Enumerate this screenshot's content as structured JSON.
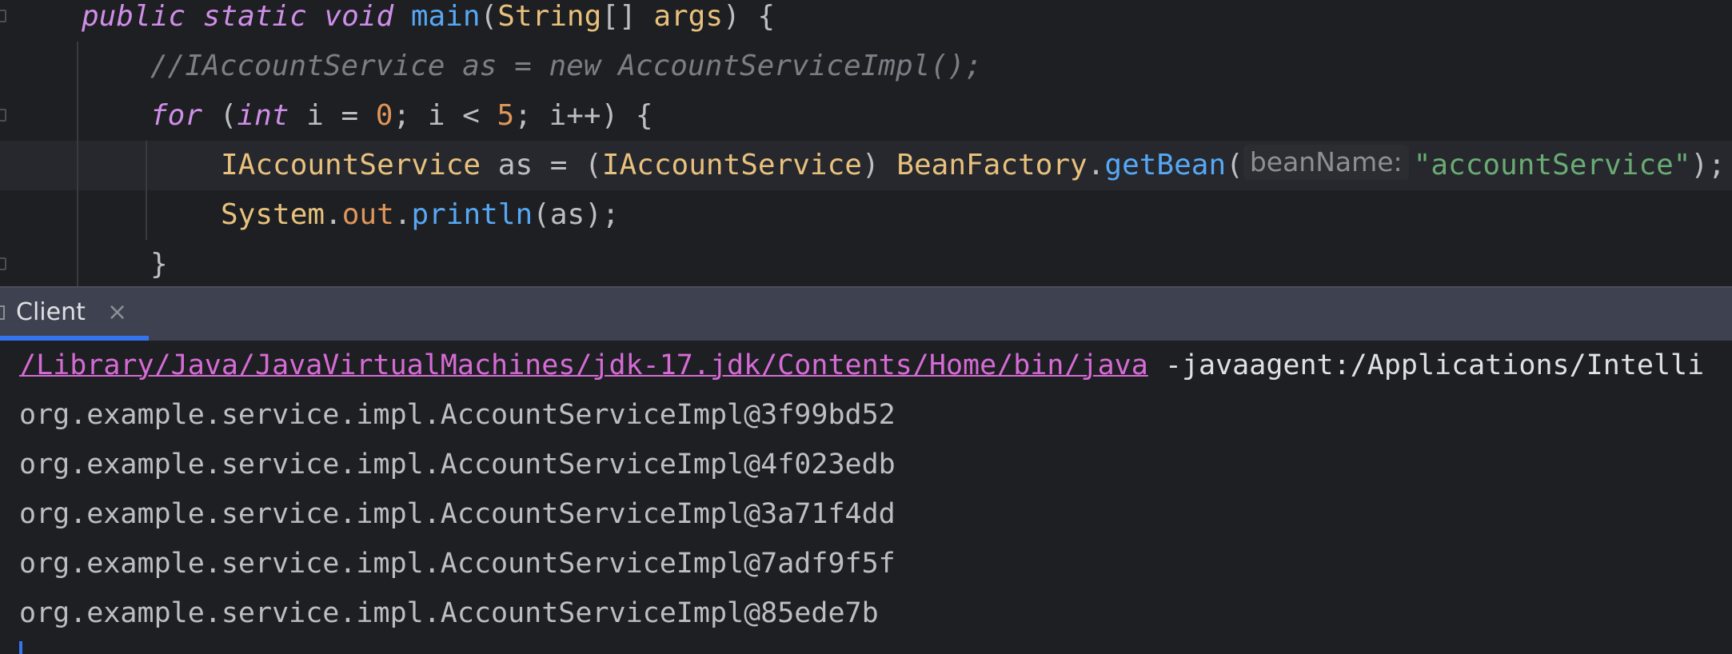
{
  "editor": {
    "line1": {
      "mods": "public static void",
      "method": "main",
      "open_paren": "(",
      "param_type": "String",
      "brackets": "[]",
      "param_name": "args",
      "close": ") {"
    },
    "line2": {
      "comment": "//IAccountService as = new AccountServiceImpl();"
    },
    "line3": {
      "kw_for": "for",
      "open": " (",
      "kw_int": "int",
      "mid1": " i = ",
      "zero": "0",
      "mid2": "; i < ",
      "five": "5",
      "tail": "; i++) {"
    },
    "line4": {
      "type1": "IAccountService",
      "mid1": " as = (",
      "type2": "IAccountService",
      "mid2": ") ",
      "factory": "BeanFactory",
      "dot": ".",
      "method": "getBean",
      "open": "(",
      "hint": "beanName:",
      "string": "\"accountService\"",
      "close": ");"
    },
    "line5": {
      "cls": "System",
      "dot1": ".",
      "field": "out",
      "dot2": ".",
      "method": "println",
      "args": "(as);"
    },
    "line6": {
      "brace": "}"
    }
  },
  "run_tab": {
    "label": "Client",
    "close_glyph": "×"
  },
  "console": {
    "command_path": "/Library/Java/JavaVirtualMachines/jdk-17.jdk/Contents/Home/bin/java",
    "command_rest": " -javaagent:/Applications/Intelli",
    "output": [
      "org.example.service.impl.AccountServiceImpl@3f99bd52",
      "org.example.service.impl.AccountServiceImpl@4f023edb",
      "org.example.service.impl.AccountServiceImpl@3a71f4dd",
      "org.example.service.impl.AccountServiceImpl@7adf9f5f",
      "org.example.service.impl.AccountServiceImpl@85ede7b"
    ]
  },
  "colors": {
    "editor_bg": "#1e1f22",
    "keyword": "#cf8ee8",
    "method": "#56a8f5",
    "type": "#e8c17c",
    "number": "#e0955a",
    "string": "#6aab73",
    "comment": "#7a7e85",
    "tab_bar": "#3e4250",
    "accent": "#3574f0",
    "link": "#d66bd6"
  },
  "icons": {
    "fold": "fold-marker-icon",
    "console": "console-icon",
    "close": "close-icon"
  }
}
